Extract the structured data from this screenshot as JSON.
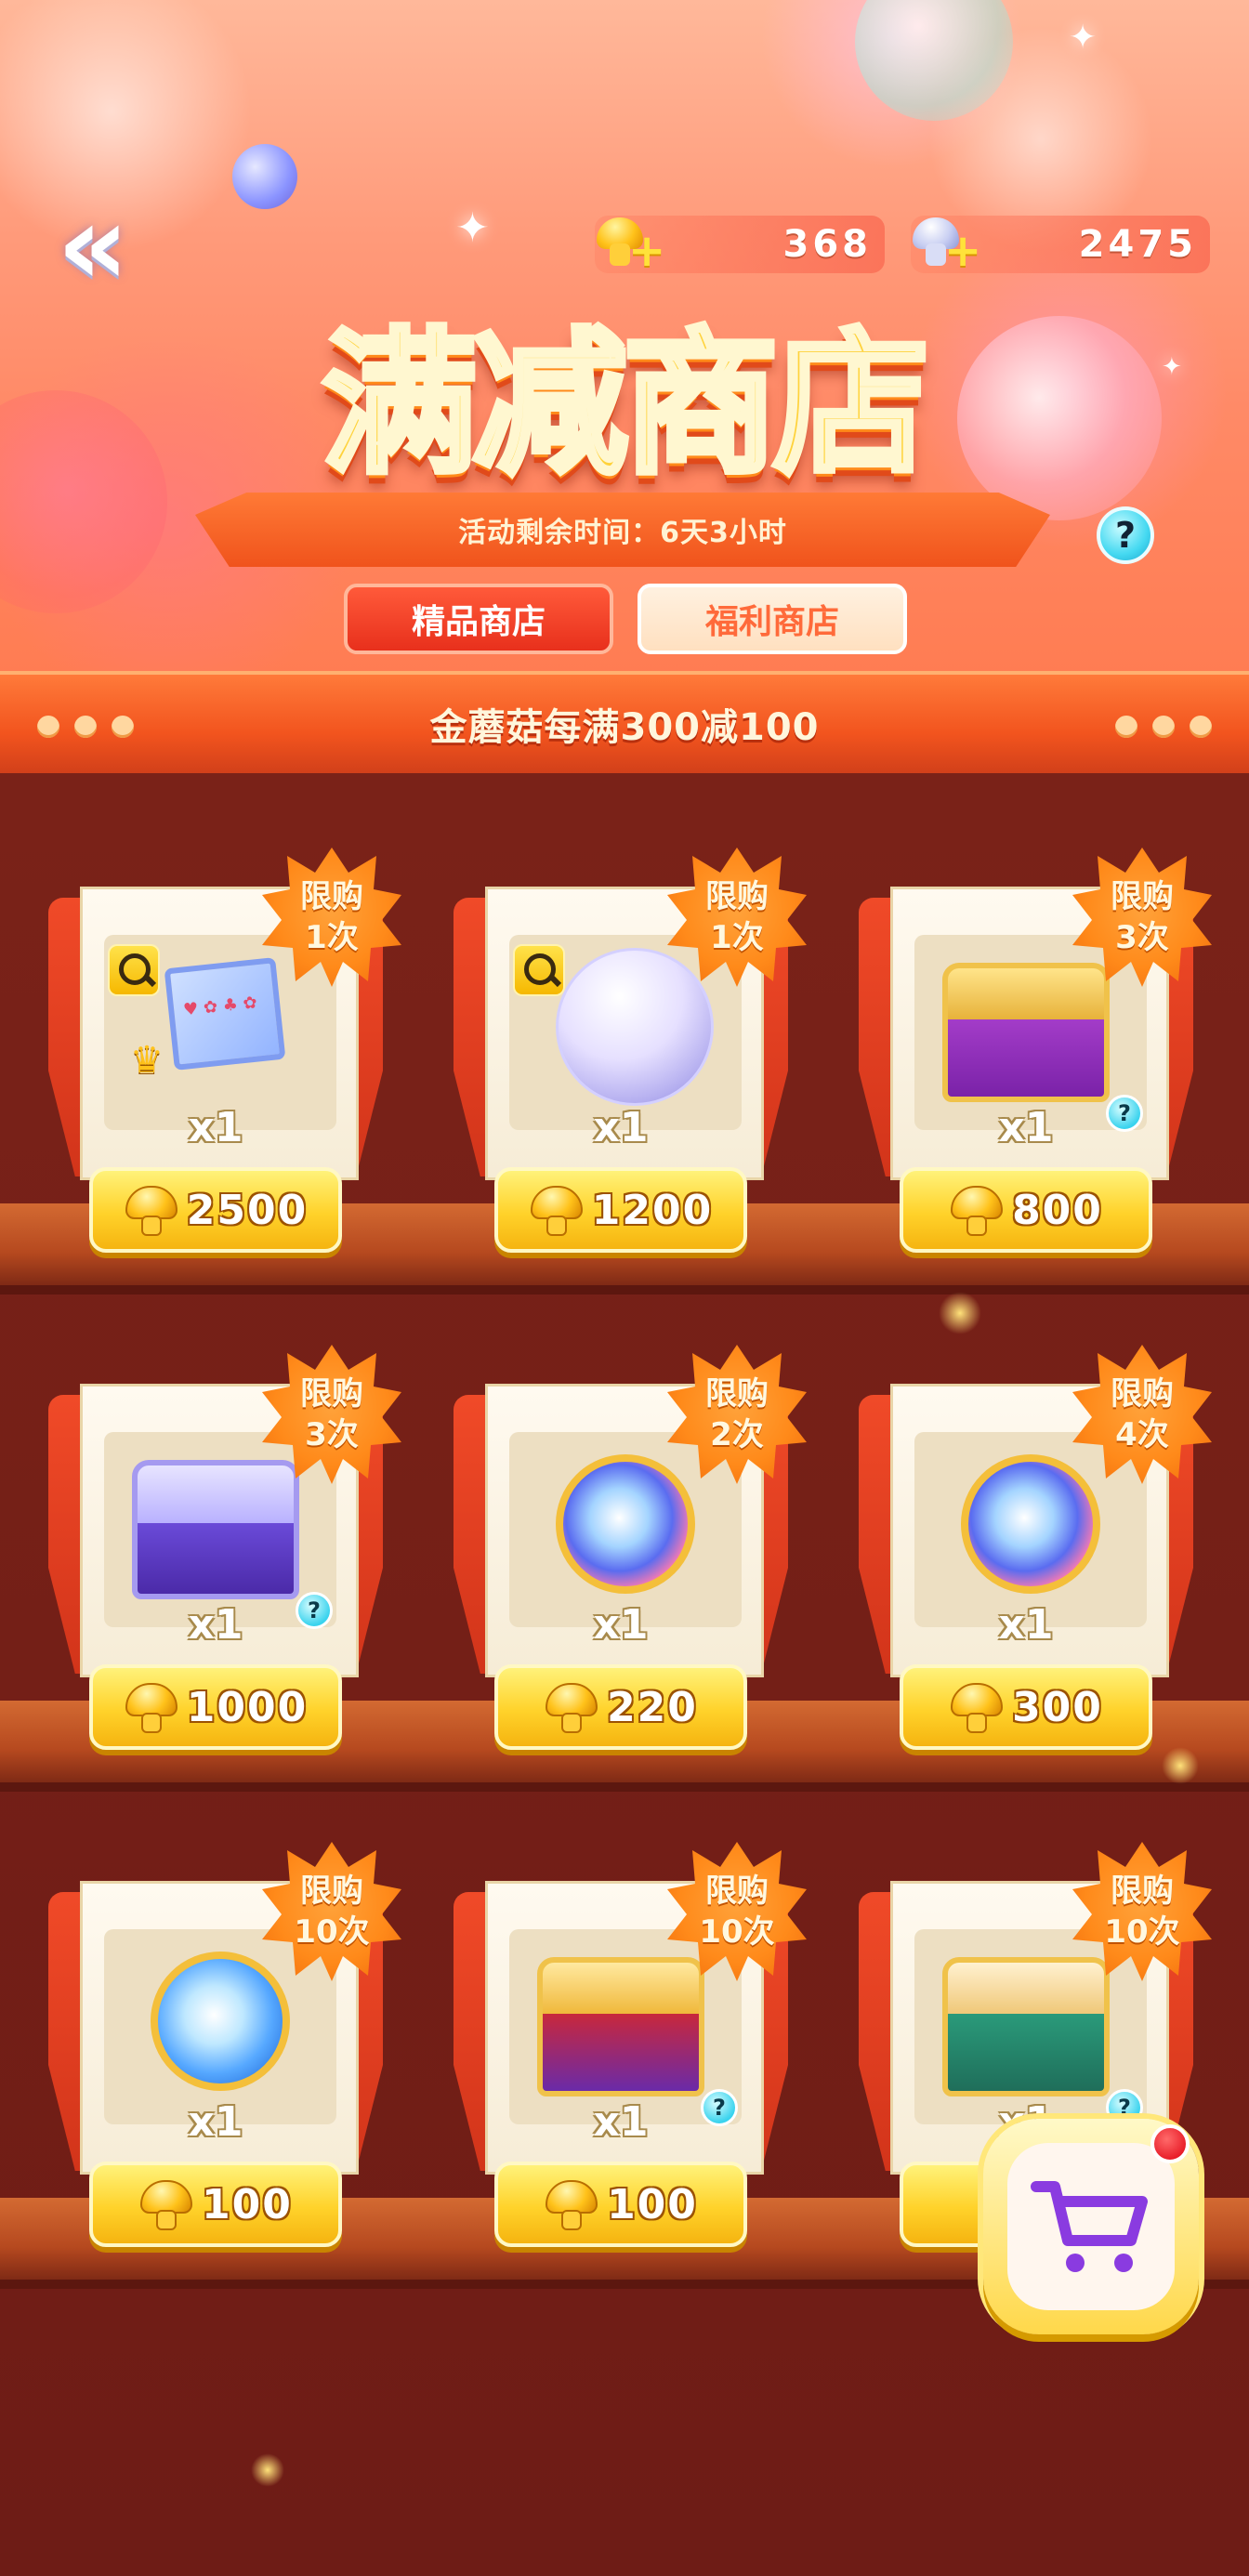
{
  "header": {
    "back_icon": "double-chevron-left-icon",
    "currencies": [
      {
        "name": "gold-mushroom",
        "value": "368",
        "icon": "gold-mushroom-plus-icon"
      },
      {
        "name": "silver-mushroom",
        "value": "2475",
        "icon": "silver-mushroom-plus-icon"
      }
    ],
    "title": "满减商店",
    "timer_text": "活动剩余时间：6天3小时",
    "help_icon": "?",
    "tabs": [
      {
        "label": "精品商店",
        "active": true
      },
      {
        "label": "福利商店",
        "active": false
      }
    ]
  },
  "promo": {
    "text": "金蘑菇每满300减100"
  },
  "items": [
    {
      "limit_line1": "限购",
      "limit_line2": "1次",
      "qty": "x1",
      "price": "2500",
      "art": "card-frame",
      "zoom": true,
      "info": false
    },
    {
      "limit_line1": "限购",
      "limit_line2": "1次",
      "qty": "x1",
      "price": "1200",
      "art": "crystal-bubble",
      "zoom": true,
      "info": false
    },
    {
      "limit_line1": "限购",
      "limit_line2": "3次",
      "qty": "x1",
      "price": "800",
      "art": "gold-purple-chest",
      "zoom": false,
      "info": true
    },
    {
      "limit_line1": "限购",
      "limit_line2": "3次",
      "qty": "x1",
      "price": "1000",
      "art": "purple-crown-chest",
      "zoom": false,
      "info": true
    },
    {
      "limit_line1": "限购",
      "limit_line2": "2次",
      "qty": "x1",
      "price": "220",
      "art": "rainbow-orb",
      "zoom": false,
      "info": false
    },
    {
      "limit_line1": "限购",
      "limit_line2": "4次",
      "qty": "x1",
      "price": "300",
      "art": "rainbow-orb",
      "zoom": false,
      "info": false
    },
    {
      "limit_line1": "限购",
      "limit_line2": "10次",
      "qty": "x1",
      "price": "100",
      "art": "blue-shell-orb",
      "zoom": false,
      "info": false
    },
    {
      "limit_line1": "限购",
      "limit_line2": "10次",
      "qty": "x1",
      "price": "100",
      "art": "red-gold-chest",
      "zoom": false,
      "info": true
    },
    {
      "limit_line1": "限购",
      "limit_line2": "10次",
      "qty": "x1",
      "price": "",
      "art": "green-gold-chest",
      "zoom": false,
      "info": true
    }
  ],
  "cart": {
    "icon": "shopping-cart-icon",
    "has_badge": true
  },
  "colors": {
    "accent": "#f0531c",
    "gold": "#ffd22a",
    "shelf": "#6e1c16"
  }
}
